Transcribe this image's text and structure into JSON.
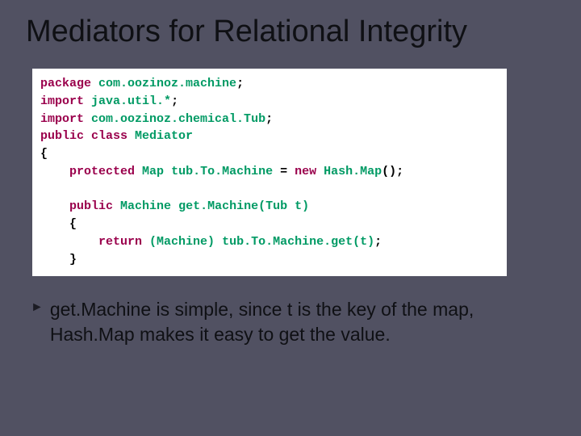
{
  "title": "Mediators for Relational Integrity",
  "code": {
    "line1_kw": "package",
    "line1_pk": "com.oozinoz.machine",
    "line2_kw": "import",
    "line2_id": "java.util.*",
    "line3_kw": "import",
    "line3_id": "com.oozinoz.chemical.Tub",
    "line4_kw": "public class",
    "line4_id": "Mediator",
    "line5_brace": "{",
    "line6_kw": "protected",
    "line6_type": "Map",
    "line6_var": "tub.To.Machine",
    "line6_eq": " = ",
    "line6_kw2": "new",
    "line6_ctor": "Hash.Map",
    "line6_tail": "();",
    "line7_kw": "public",
    "line7_ret": "Machine",
    "line7_name": "get.Machine",
    "line7_params": "(Tub t)",
    "line8_brace": "{",
    "line9_kw": "return",
    "line9_cast": "(Machine)",
    "line9_expr": "tub.To.Machine.get(t)",
    "line9_tail": ";",
    "line10_brace": "}"
  },
  "bullet": {
    "marker": "►",
    "text": "get.Machine is simple, since t is the key of the map, Hash.Map makes it easy to get the value."
  }
}
